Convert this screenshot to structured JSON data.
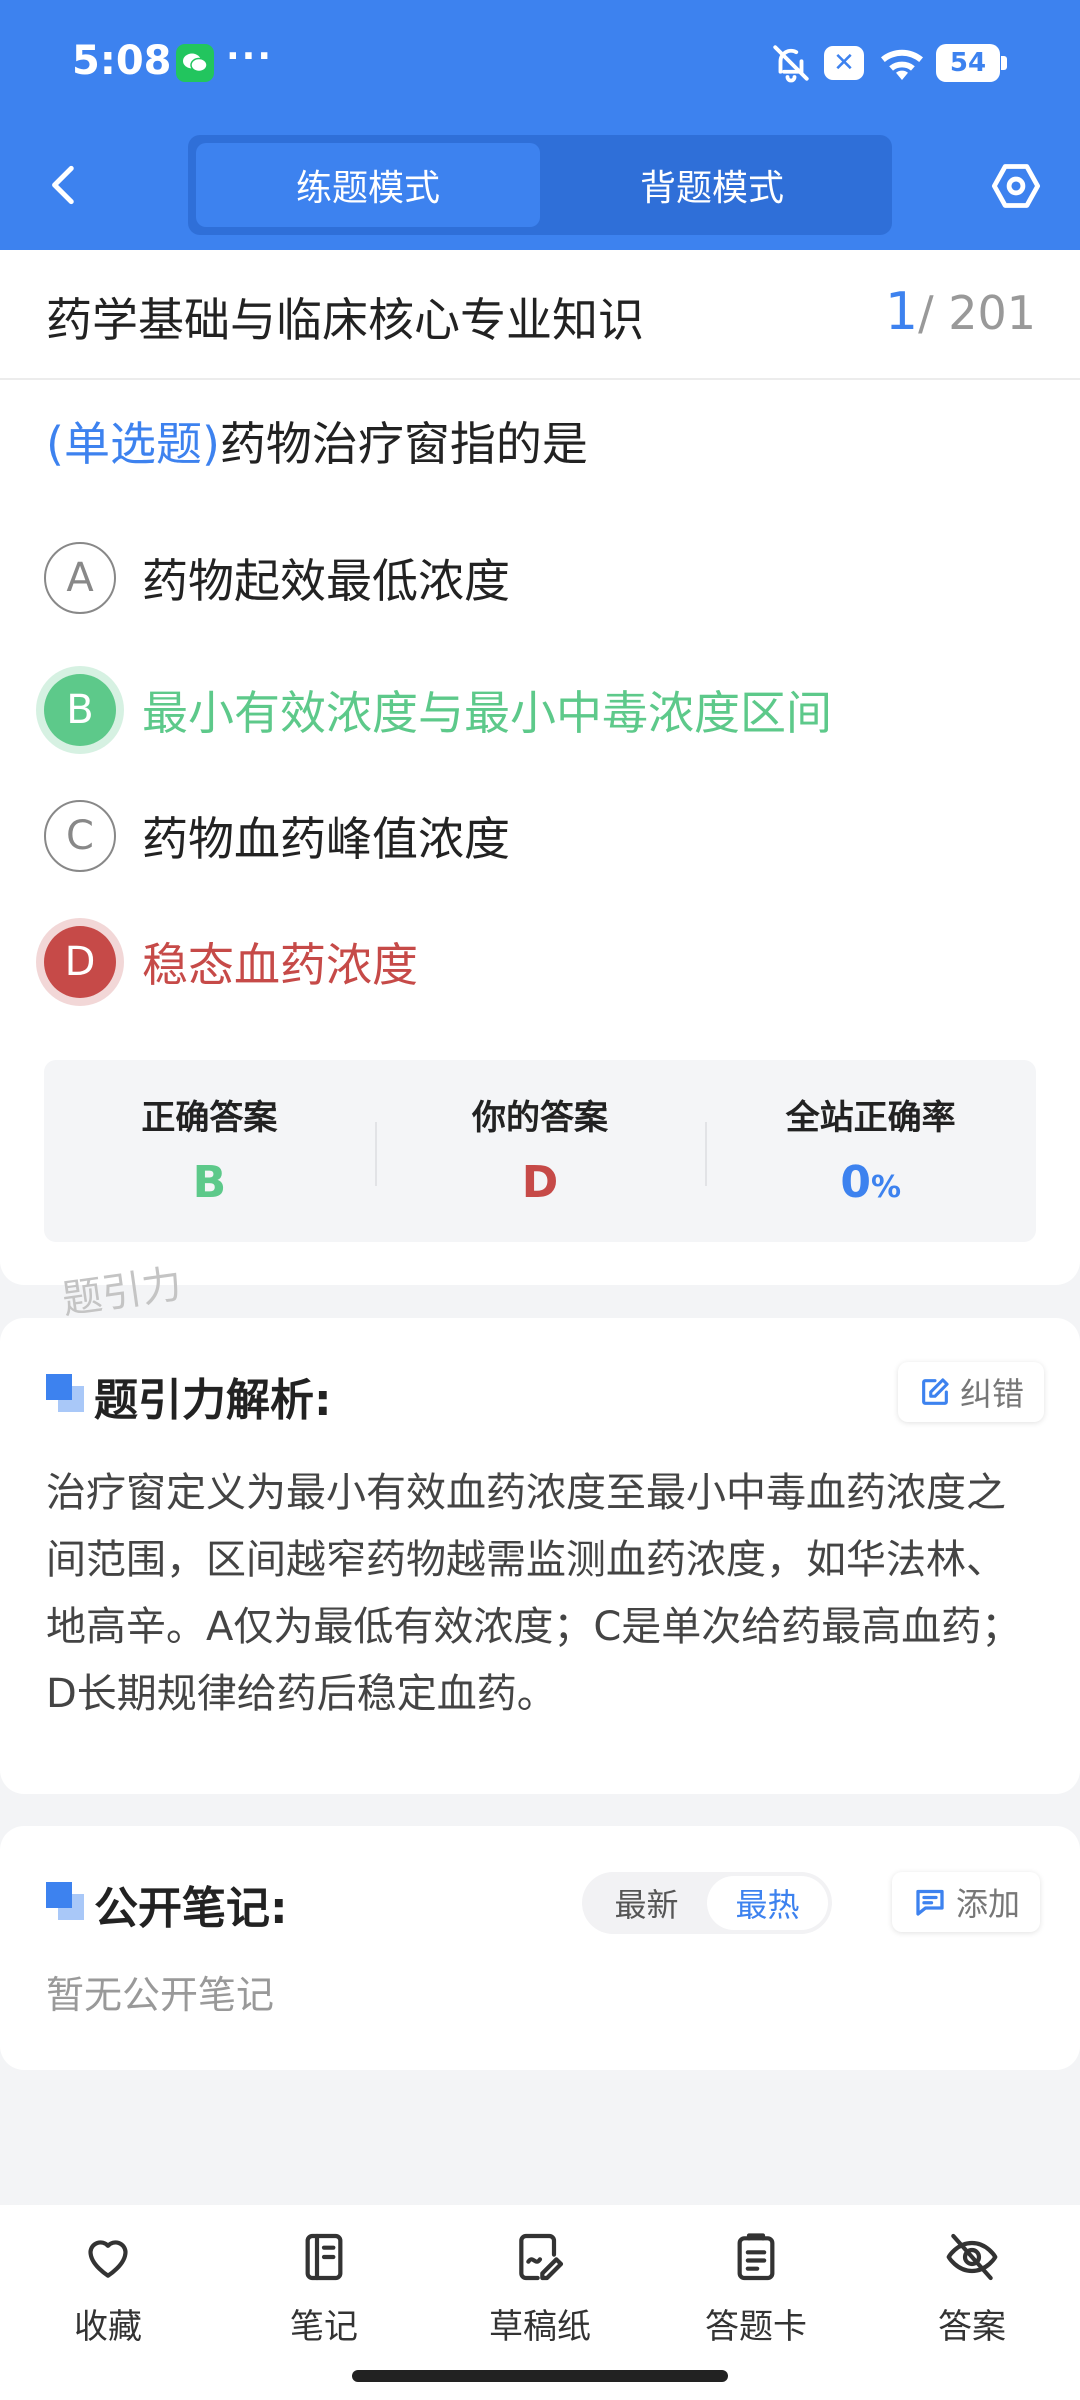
{
  "status_bar": {
    "time": "5:08",
    "dots": "···",
    "battery": "54"
  },
  "header": {
    "modes": [
      {
        "label": "练题模式",
        "active": true
      },
      {
        "label": "背题模式",
        "active": false
      }
    ]
  },
  "question": {
    "subject": "药学基础与临床核心专业知识",
    "current": "1",
    "total": "/ 201",
    "type": "(单选题)",
    "text": "药物治疗窗指的是",
    "options": [
      {
        "letter": "A",
        "text": "药物起效最低浓度",
        "state": "normal"
      },
      {
        "letter": "B",
        "text": "最小有效浓度与最小中毒浓度区间",
        "state": "correct"
      },
      {
        "letter": "C",
        "text": "药物血药峰值浓度",
        "state": "normal"
      },
      {
        "letter": "D",
        "text": "稳态血药浓度",
        "state": "wrong"
      }
    ]
  },
  "answer_summary": {
    "correct_label": "正确答案",
    "correct_value": "B",
    "yours_label": "你的答案",
    "yours_value": "D",
    "rate_label": "全站正确率",
    "rate_value": "0",
    "rate_unit": "%"
  },
  "watermark": "题引力",
  "analysis": {
    "title": "题引力解析:",
    "report_label": "纠错",
    "text": "治疗窗定义为最小有效血药浓度至最小中毒血药浓度之间范围，区间越窄药物越需监测血药浓度，如华法林、地高辛。A仅为最低有效浓度；C是单次给药最高血药；D长期规律给药后稳定血药。"
  },
  "notes": {
    "title": "公开笔记:",
    "sort_latest": "最新",
    "sort_hot": "最热",
    "add_label": "添加",
    "empty_text": "暂无公开笔记"
  },
  "bottom_bar": [
    {
      "label": "收藏",
      "icon": "heart-icon"
    },
    {
      "label": "笔记",
      "icon": "notebook-icon"
    },
    {
      "label": "草稿纸",
      "icon": "draft-icon"
    },
    {
      "label": "答题卡",
      "icon": "clipboard-icon"
    },
    {
      "label": "答案",
      "icon": "eye-off-icon"
    }
  ],
  "colors": {
    "primary": "#3d82ef",
    "correct": "#5dc98a",
    "wrong": "#c64a48"
  }
}
